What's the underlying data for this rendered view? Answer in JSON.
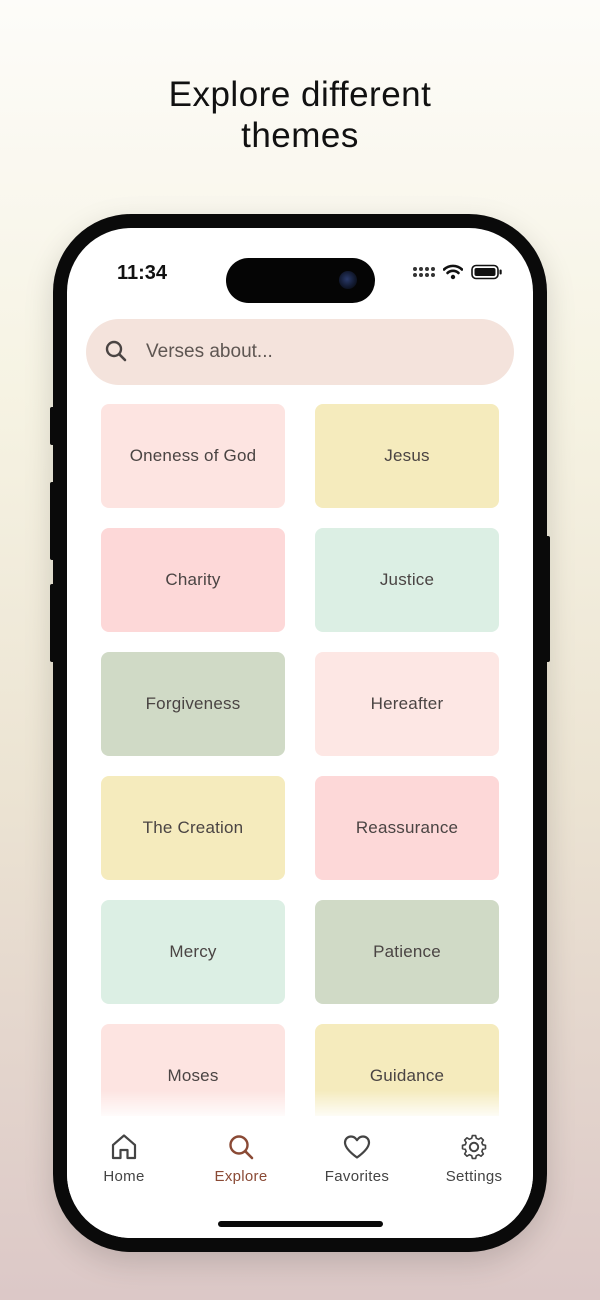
{
  "headline": {
    "line1": "Explore different",
    "line2": "themes"
  },
  "status_bar": {
    "time": "11:34"
  },
  "search": {
    "placeholder": "Verses about..."
  },
  "themes": [
    {
      "label": "Oneness of God",
      "color": "#fde4e1"
    },
    {
      "label": "Jesus",
      "color": "#f5ebbd"
    },
    {
      "label": "Charity",
      "color": "#fdd8d8"
    },
    {
      "label": "Justice",
      "color": "#dcefe4"
    },
    {
      "label": "Forgiveness",
      "color": "#d0dac6"
    },
    {
      "label": "Hereafter",
      "color": "#fde7e4"
    },
    {
      "label": "The Creation",
      "color": "#f5ebbd"
    },
    {
      "label": "Reassurance",
      "color": "#fdd8d8"
    },
    {
      "label": "Mercy",
      "color": "#dcefe4"
    },
    {
      "label": "Patience",
      "color": "#d0dac6"
    },
    {
      "label": "Moses",
      "color": "#fde4e1"
    },
    {
      "label": "Guidance",
      "color": "#f5ebbd"
    }
  ],
  "tabbar": {
    "home": {
      "label": "Home",
      "icon": "home-icon"
    },
    "explore": {
      "label": "Explore",
      "icon": "search-icon",
      "active": true
    },
    "favorites": {
      "label": "Favorites",
      "icon": "heart-icon"
    },
    "settings": {
      "label": "Settings",
      "icon": "gear-icon"
    }
  },
  "colors": {
    "accent": "#8a4a35",
    "search_bg": "#f4e3dc"
  }
}
